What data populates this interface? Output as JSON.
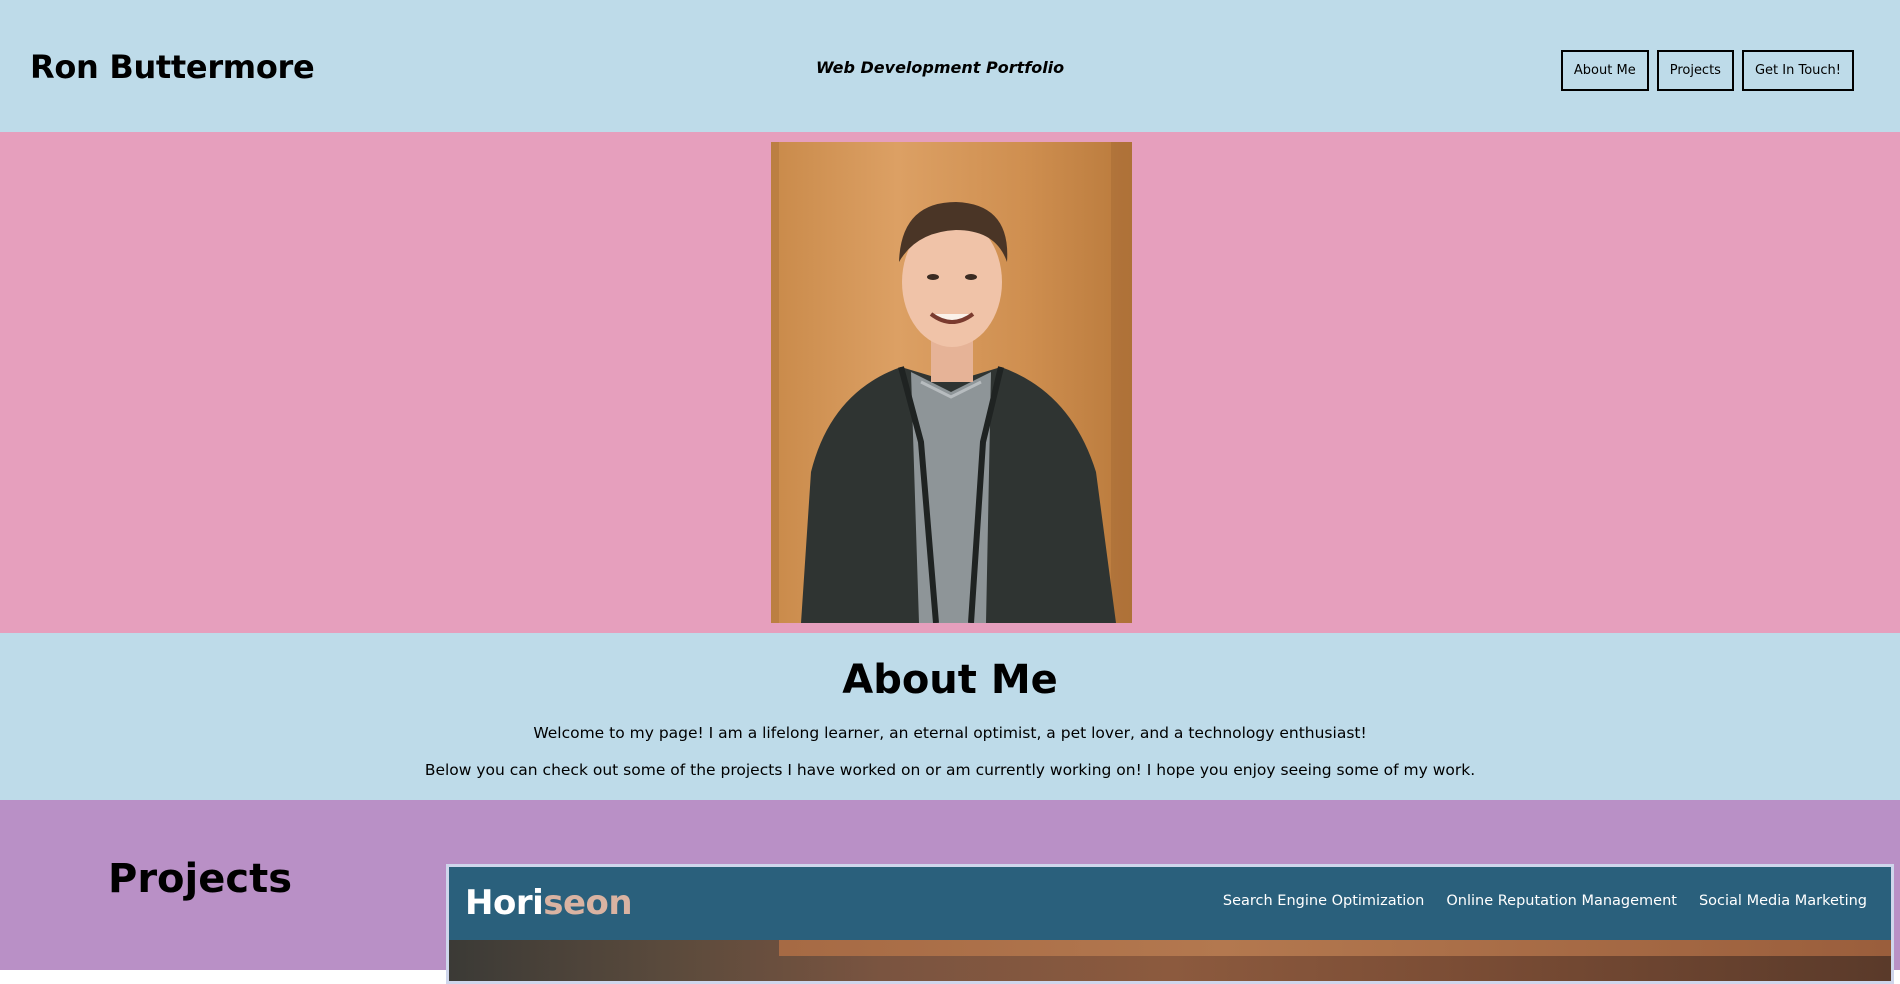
{
  "header": {
    "title": "Ron Buttermore",
    "tagline": "Web Development Portfolio",
    "nav": [
      "About Me",
      "Projects",
      "Get In Touch!"
    ]
  },
  "hero": {
    "photo_icon": "portrait-photo"
  },
  "about": {
    "heading": "About Me",
    "paragraph1": "Welcome to my page! I am a lifelong learner, an eternal optimist, a pet lover, and a technology enthusiast!",
    "paragraph2": "Below you can check out some of the projects I have worked on or am currently working on! I hope you enjoy seeing some of my work."
  },
  "projects": {
    "heading": "Projects",
    "card": {
      "logo_main": "Hori",
      "logo_accent": "seon",
      "nav": [
        "Search Engine Optimization",
        "Online Reputation Management",
        "Social Media Marketing"
      ]
    }
  },
  "colors": {
    "header_bg": "#bedbe9",
    "hero_bg": "#e69fbd",
    "about_bg": "#bedbe9",
    "projects_bg": "#b990c6",
    "card_header_bg": "#2a607c"
  }
}
